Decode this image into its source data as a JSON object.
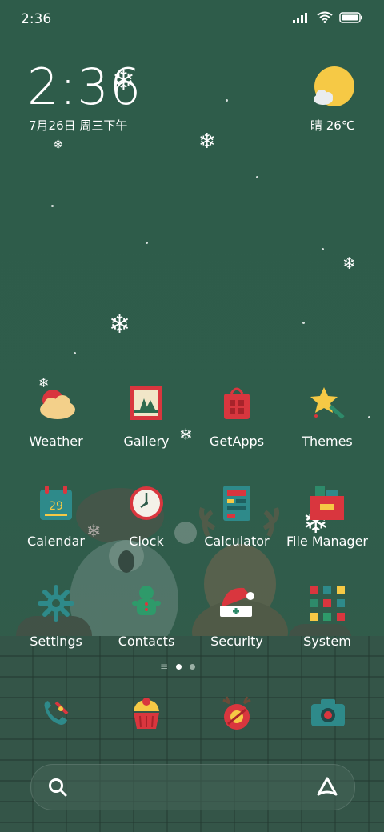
{
  "status_bar": {
    "time": "2:36"
  },
  "clock_widget": {
    "time": "2:36",
    "date": "7月26日 周三下午"
  },
  "weather_widget": {
    "text": "晴 26℃"
  },
  "apps": [
    {
      "label": "Weather",
      "icon": "weather-icon"
    },
    {
      "label": "Gallery",
      "icon": "gallery-icon"
    },
    {
      "label": "GetApps",
      "icon": "getapps-icon"
    },
    {
      "label": "Themes",
      "icon": "themes-icon"
    },
    {
      "label": "Calendar",
      "icon": "calendar-icon",
      "badge": "29"
    },
    {
      "label": "Clock",
      "icon": "clock-icon"
    },
    {
      "label": "Calculator",
      "icon": "calculator-icon"
    },
    {
      "label": "File Manager",
      "icon": "file-manager-icon"
    },
    {
      "label": "Settings",
      "icon": "settings-icon"
    },
    {
      "label": "Contacts",
      "icon": "contacts-icon"
    },
    {
      "label": "Security",
      "icon": "security-icon"
    },
    {
      "label": "System",
      "icon": "system-folder-icon"
    }
  ],
  "dock": [
    {
      "icon": "phone-icon"
    },
    {
      "icon": "messages-icon"
    },
    {
      "icon": "browser-icon"
    },
    {
      "icon": "camera-icon"
    }
  ],
  "page_indicator": {
    "pages": 2,
    "active": 1
  },
  "colors": {
    "background": "#2f5c4a",
    "sun": "#f6c945",
    "accent_red": "#d9363e",
    "teal": "#2e8a8a"
  }
}
